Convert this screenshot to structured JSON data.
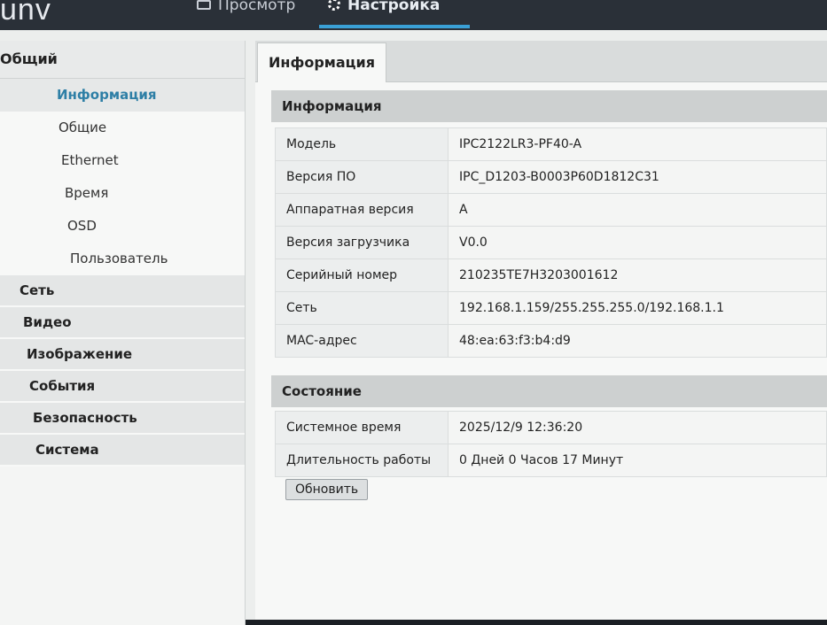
{
  "header": {
    "logo_text": "unv",
    "tabs": [
      {
        "label": "Просмотр"
      },
      {
        "label": "Настройка"
      }
    ]
  },
  "sidebar": {
    "group_title": "Общий",
    "sub_items": [
      {
        "label": "Информация"
      },
      {
        "label": "Общие"
      },
      {
        "label": "Ethernet"
      },
      {
        "label": "Время"
      },
      {
        "label": "OSD"
      },
      {
        "label": "Пользователь"
      }
    ],
    "categories": [
      {
        "label": "Сеть"
      },
      {
        "label": "Видео"
      },
      {
        "label": "Изображение"
      },
      {
        "label": "События"
      },
      {
        "label": "Безопасность"
      },
      {
        "label": "Система"
      }
    ]
  },
  "main": {
    "tab_label": "Информация",
    "info_section": {
      "title": "Информация",
      "rows": [
        {
          "label": "Модель",
          "value": "IPC2122LR3-PF40-A"
        },
        {
          "label": "Версия ПО",
          "value": "IPC_D1203-B0003P60D1812C31"
        },
        {
          "label": "Аппаратная версия",
          "value": "A"
        },
        {
          "label": "Версия загрузчика",
          "value": "V0.0"
        },
        {
          "label": "Серийный номер",
          "value": "210235TE7H3203001612"
        },
        {
          "label": "Сеть",
          "value": "192.168.1.159/255.255.255.0/192.168.1.1"
        },
        {
          "label": "MAC-адрес",
          "value": "48:ea:63:f3:b4:d9"
        }
      ]
    },
    "status_section": {
      "title": "Состояние",
      "rows": [
        {
          "label": "Системное время",
          "value": "2025/12/9 12:36:20"
        },
        {
          "label": "Длительность работы",
          "value": "0 Дней 0 Часов 17 Минут"
        }
      ]
    },
    "refresh_label": "Обновить"
  },
  "colors": {
    "accent": "#3aa0d6",
    "active_sidebar_text": "#2e7fa6",
    "header_bg": "#2a3038"
  }
}
